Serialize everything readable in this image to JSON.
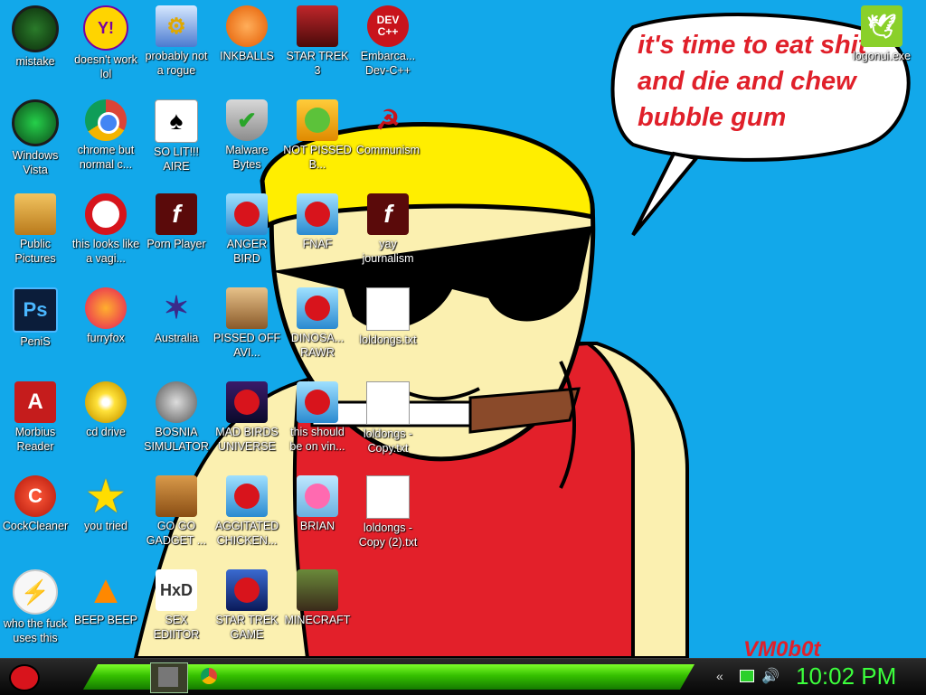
{
  "desktop": {
    "speech_bubble": "it's time to eat shit and die and chew bubble gum",
    "signature": "VM0b0t",
    "icons": [
      {
        "label": "mistake",
        "icon": "green-orb-icon"
      },
      {
        "label": "doesn't work lol",
        "icon": "yahoo-messenger-icon"
      },
      {
        "label": "probably not a rogue",
        "icon": "control-panel-icon"
      },
      {
        "label": "INKBALLS",
        "icon": "inkball-icon"
      },
      {
        "label": "STAR TREK 3",
        "icon": "star-wars-icon"
      },
      {
        "label": "Embarca... Dev-C++",
        "icon": "devcpp-icon"
      },
      {
        "label": "Windows Vista",
        "icon": "recycle-bin-icon"
      },
      {
        "label": "chrome but normal c...",
        "icon": "chrome-icon"
      },
      {
        "label": "SO LIT!!! AIRE",
        "icon": "solitaire-icon"
      },
      {
        "label": "Malware Bytes",
        "icon": "shield-icon"
      },
      {
        "label": "NOT PISSED B...",
        "icon": "bad-piggies-icon"
      },
      {
        "label": "Communism",
        "icon": "communism-icon"
      },
      {
        "label": "Public Pictures",
        "icon": "folder-icon"
      },
      {
        "label": "this looks like a vagi...",
        "icon": "opera-icon"
      },
      {
        "label": "Porn Player",
        "icon": "flash-icon"
      },
      {
        "label": "ANGER BIRD",
        "icon": "angry-bird-icon"
      },
      {
        "label": "FNAF",
        "icon": "angry-bird-icon"
      },
      {
        "label": "yay journalism",
        "icon": "flash-icon"
      },
      {
        "label": "PeniS",
        "icon": "photoshop-icon"
      },
      {
        "label": "furryfox",
        "icon": "firefox-icon"
      },
      {
        "label": "Australia",
        "icon": "spider-solitaire-icon"
      },
      {
        "label": "PISSED OFF AVI...",
        "icon": "angry-birds-seasons-icon"
      },
      {
        "label": "DINOSA... RAWR",
        "icon": "angry-bird-icon"
      },
      {
        "label": "loldongs.txt",
        "icon": "text-file-icon"
      },
      {
        "label": "Morbius Reader",
        "icon": "acrobat-icon"
      },
      {
        "label": "cd drive",
        "icon": "cd-icon"
      },
      {
        "label": "BOSNIA SIMULATOR",
        "icon": "mine-icon"
      },
      {
        "label": "MAD BIRDS UNIVERSE",
        "icon": "angry-birds-space-icon"
      },
      {
        "label": "this should be on vin...",
        "icon": "angry-bird-icon"
      },
      {
        "label": "loldongs - Copy.txt",
        "icon": "text-file-icon"
      },
      {
        "label": "CockCleaner",
        "icon": "ccleaner-icon"
      },
      {
        "label": "you tried",
        "icon": "star-icon"
      },
      {
        "label": "GO GO GADGET ...",
        "icon": "briefcase-icon"
      },
      {
        "label": "AGGITATED CHICKEN...",
        "icon": "angry-bird-icon"
      },
      {
        "label": "BRIAN",
        "icon": "angry-birds-stella-icon"
      },
      {
        "label": "loldongs - Copy (2).txt",
        "icon": "text-file-icon"
      },
      {
        "label": "who the fuck uses this",
        "icon": "winamp-icon"
      },
      {
        "label": "BEEP BEEP",
        "icon": "vlc-icon"
      },
      {
        "label": "SEX EDIITOR",
        "icon": "hxd-icon"
      },
      {
        "label": "STAR TREK GAME",
        "icon": "angry-birds-star-wars-icon"
      },
      {
        "label": "MINECRAFT",
        "icon": "minecraft-icon"
      },
      {
        "label": "logonui.exe",
        "icon": "duck-icon"
      }
    ]
  },
  "taskbar": {
    "clock": "10:02 PM",
    "start_icon": "angry-bird-icon",
    "pinned": [
      "app-thumbnail-icon",
      "chrome-icon"
    ],
    "tray": [
      "back-arrow-icon",
      "network-icon",
      "volume-icon"
    ]
  },
  "colors": {
    "sky": "#12a8ea",
    "clock": "#3cff3c",
    "bubble_text": "#e0202a",
    "skin": "#fbf0b0",
    "hat": "#ffee00",
    "shirt": "#e3202a"
  }
}
